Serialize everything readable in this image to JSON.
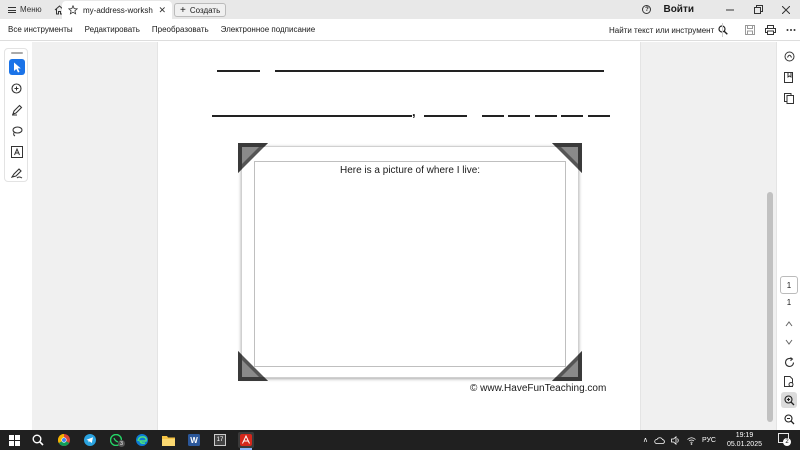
{
  "titlebar": {
    "menu_label": "Меню",
    "tab_title": "my-address-workshee...",
    "new_tab_label": "Создать",
    "signin_label": "Войти"
  },
  "toolbar": {
    "items": [
      "Все инструменты",
      "Редактировать",
      "Преобразовать",
      "Электронное подписание"
    ],
    "find_label": "Найти текст или инструмент"
  },
  "document": {
    "caption": "Here is a picture of where I live:",
    "credit": "© www.HaveFunTeaching.com",
    "comma": ","
  },
  "navigation": {
    "current_page": "1",
    "total_pages": "1"
  },
  "taskbar": {
    "apps": [
      "start-icon",
      "search-icon",
      "chrome-icon",
      "telegram-icon",
      "whatsapp-icon",
      "edge-icon",
      "file-explorer-icon",
      "word-icon",
      "calendar-app-icon",
      "acrobat-icon"
    ],
    "whatsapp_badge": "3",
    "calendar_label": "17",
    "language": "РУС",
    "time": "19:19",
    "date": "05.01.2025",
    "notifications": "2"
  },
  "colors": {
    "accent": "#1a73e8",
    "acrobat": "#d4271b",
    "taskbar": "#202020"
  }
}
